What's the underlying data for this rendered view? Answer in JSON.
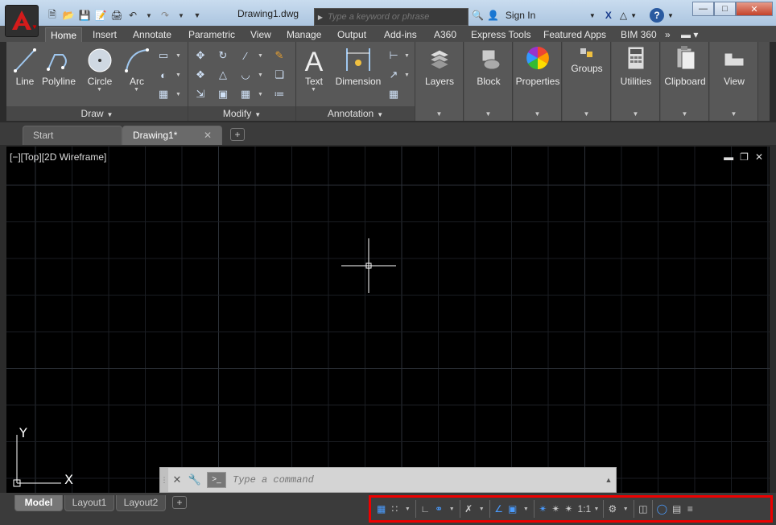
{
  "window": {
    "title": "Drawing1.dwg",
    "search_placeholder": "Type a keyword or phrase",
    "sign_in": "Sign In"
  },
  "ribbon_tabs": [
    "Home",
    "Insert",
    "Annotate",
    "Parametric",
    "View",
    "Manage",
    "Output",
    "Add-ins",
    "A360",
    "Express Tools",
    "Featured Apps",
    "BIM 360"
  ],
  "panels": {
    "draw": {
      "title": "Draw",
      "tools": [
        "Line",
        "Polyline",
        "Circle",
        "Arc"
      ]
    },
    "modify": {
      "title": "Modify"
    },
    "annotation": {
      "title": "Annotation",
      "tools": [
        "Text",
        "Dimension"
      ]
    },
    "layers": "Layers",
    "block": "Block",
    "properties": "Properties",
    "groups": "Groups",
    "utilities": "Utilities",
    "clipboard": "Clipboard",
    "view": "View"
  },
  "file_tabs": {
    "start": "Start",
    "drawing": "Drawing1*"
  },
  "viewport": {
    "label": "[−][Top][2D Wireframe]",
    "ucs_x": "X",
    "ucs_y": "Y"
  },
  "command_line": {
    "placeholder": "Type a command"
  },
  "layout_tabs": [
    "Model",
    "Layout1",
    "Layout2"
  ],
  "status": {
    "scale": "1:1"
  },
  "colors": {
    "accent_red": "#e00000",
    "viewport_bg": "#000000",
    "ribbon_bg": "#585858"
  }
}
